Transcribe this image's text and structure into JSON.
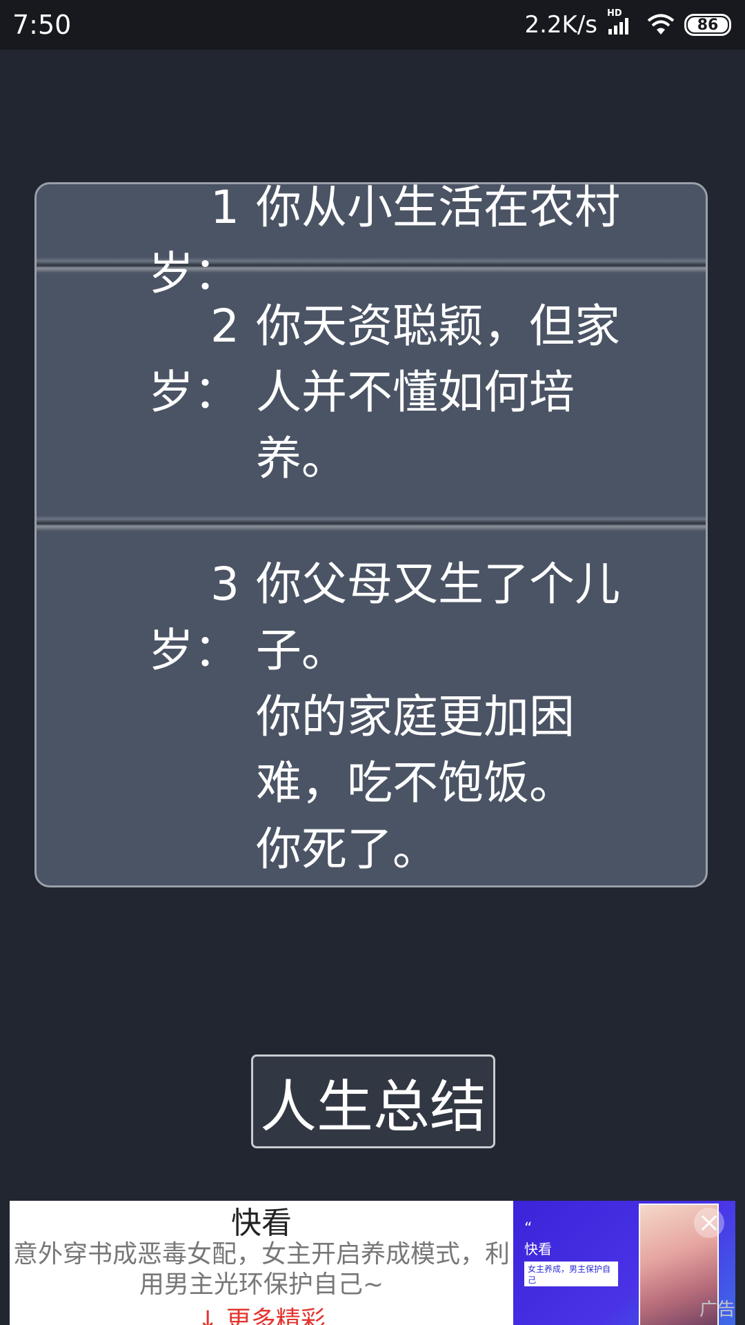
{
  "status_bar": {
    "time": "7:50",
    "network_speed": "2.2K/s",
    "signal_label": "HD",
    "battery": "86"
  },
  "log": {
    "entries": [
      {
        "age": "1岁：",
        "text": "你从小生活在农村"
      },
      {
        "age": "2岁：",
        "text": "你天资聪颖，但家\n人并不懂如何培\n养。"
      },
      {
        "age": "3岁：",
        "text": "你父母又生了个儿\n子。\n你的家庭更加困\n难，吃不饱饭。\n你死了。"
      }
    ]
  },
  "summary_button": {
    "label": "人生总结"
  },
  "ad": {
    "title": "快看",
    "description": "意外穿书成恶毒女配，女主开启养成模式，利用男主光环保护自己~",
    "more_label": "更多精彩",
    "image_quote": "“",
    "image_brand": "快看",
    "image_chip": "女主养成，男主保护自己",
    "tag": "广告"
  },
  "colors": {
    "background": "#212630",
    "panel": "#4b5465",
    "status_bar": "#17191e",
    "accent_red": "#e3342f"
  }
}
